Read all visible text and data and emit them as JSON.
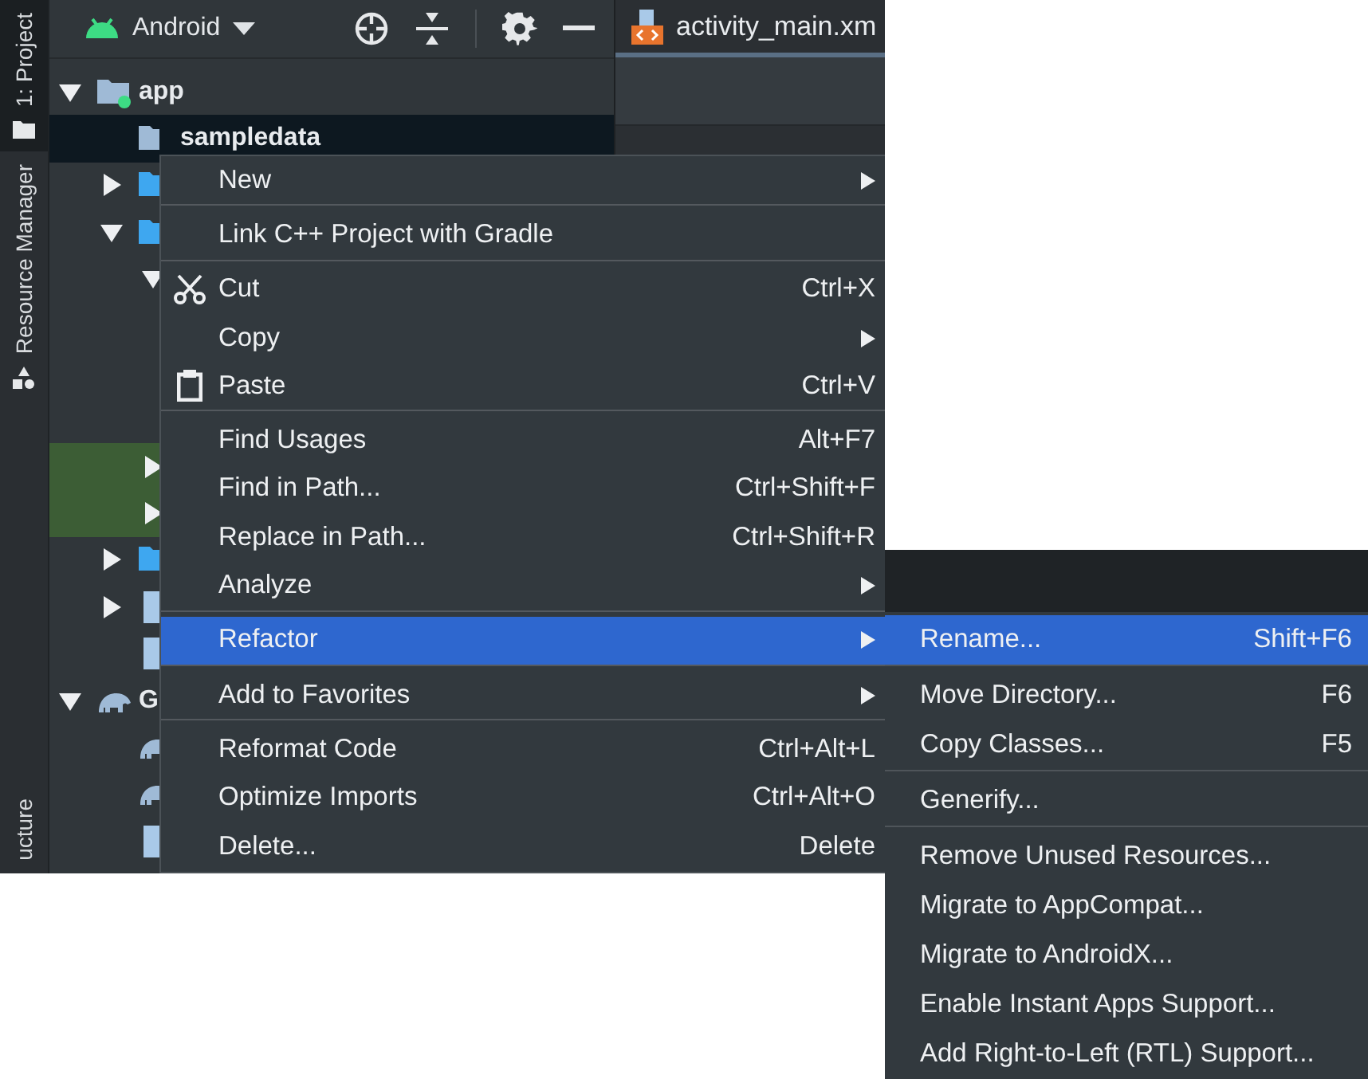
{
  "side_strip": {
    "tabs": [
      {
        "label": "1: Project",
        "kind": "project",
        "selected": true
      },
      {
        "label": "Resource Manager",
        "kind": "resources",
        "selected": false
      }
    ],
    "bottom_tabs": [
      {
        "label": "ucture",
        "selected": false
      }
    ]
  },
  "project_panel": {
    "view_selector": "Android",
    "tree": [
      {
        "label": "app",
        "kind": "module",
        "expanded": true,
        "selected": false,
        "highlighted": false,
        "children": [
          {
            "label": "sampledata",
            "kind": "folder",
            "selected": true,
            "highlighted": false
          },
          {
            "kind": "source-folder",
            "expanded": false,
            "selected": false,
            "highlighted": false
          },
          {
            "kind": "source-folder",
            "expanded": true,
            "selected": false,
            "highlighted": false,
            "children": [
              {
                "expanded": true,
                "selected": false,
                "highlighted": false
              },
              {
                "expanded": false,
                "selected": false,
                "highlighted": true
              },
              {
                "expanded": false,
                "selected": false,
                "highlighted": true
              }
            ]
          },
          {
            "kind": "source-folder",
            "expanded": false,
            "selected": false,
            "highlighted": false
          },
          {
            "kind": "file",
            "expanded": false,
            "selected": false,
            "highlighted": false
          },
          {
            "kind": "file",
            "selected": false,
            "highlighted": false
          }
        ]
      },
      {
        "label": "G",
        "kind": "gradle",
        "expanded": true,
        "selected": false,
        "highlighted": false,
        "children": [
          {
            "kind": "gradle",
            "selected": false,
            "highlighted": false
          },
          {
            "kind": "gradle",
            "selected": false,
            "highlighted": false
          },
          {
            "kind": "file",
            "selected": false,
            "highlighted": false
          }
        ]
      }
    ]
  },
  "editor": {
    "tabs": [
      {
        "label": "activity_main.xm",
        "selected": true
      }
    ]
  },
  "context_menu": {
    "groups": [
      [
        {
          "label": "New",
          "kind": "command",
          "submenu": true,
          "selected": false
        }
      ],
      [
        {
          "label": "Link C++ Project with Gradle",
          "kind": "command",
          "submenu": false,
          "selected": false
        }
      ],
      [
        {
          "label": "Cut",
          "kind": "cut",
          "shortcut": "Ctrl+X",
          "submenu": false,
          "selected": false
        },
        {
          "label": "Copy",
          "kind": "command",
          "submenu": true,
          "selected": false
        },
        {
          "label": "Paste",
          "kind": "paste",
          "shortcut": "Ctrl+V",
          "submenu": false,
          "selected": false
        }
      ],
      [
        {
          "label": "Find Usages",
          "kind": "command",
          "shortcut": "Alt+F7",
          "submenu": false,
          "selected": false
        },
        {
          "label": "Find in Path...",
          "kind": "command",
          "shortcut": "Ctrl+Shift+F",
          "submenu": false,
          "selected": false
        },
        {
          "label": "Replace in Path...",
          "kind": "command",
          "shortcut": "Ctrl+Shift+R",
          "submenu": false,
          "selected": false
        },
        {
          "label": "Analyze",
          "kind": "command",
          "submenu": true,
          "selected": false
        }
      ],
      [
        {
          "label": "Refactor",
          "kind": "command",
          "submenu": true,
          "selected": true
        }
      ],
      [
        {
          "label": "Add to Favorites",
          "kind": "command",
          "submenu": true,
          "selected": false
        }
      ],
      [
        {
          "label": "Reformat Code",
          "kind": "command",
          "shortcut": "Ctrl+Alt+L",
          "submenu": false,
          "selected": false
        },
        {
          "label": "Optimize Imports",
          "kind": "command",
          "shortcut": "Ctrl+Alt+O",
          "submenu": false,
          "selected": false
        },
        {
          "label": "Delete...",
          "kind": "command",
          "shortcut": "Delete",
          "submenu": false,
          "selected": false
        }
      ]
    ]
  },
  "refactor_submenu": {
    "groups": [
      [
        {
          "label": "Rename...",
          "shortcut": "Shift+F6",
          "selected": true
        }
      ],
      [
        {
          "label": "Move Directory...",
          "shortcut": "F6",
          "selected": false
        },
        {
          "label": "Copy Classes...",
          "shortcut": "F5",
          "selected": false
        }
      ],
      [
        {
          "label": "Generify...",
          "selected": false
        }
      ],
      [
        {
          "label": "Remove Unused Resources...",
          "selected": false
        },
        {
          "label": "Migrate to AppCompat...",
          "selected": false
        },
        {
          "label": "Migrate to AndroidX...",
          "selected": false
        },
        {
          "label": "Enable Instant Apps Support...",
          "selected": false
        },
        {
          "label": "Add Right-to-Left (RTL) Support...",
          "selected": false
        }
      ]
    ]
  }
}
